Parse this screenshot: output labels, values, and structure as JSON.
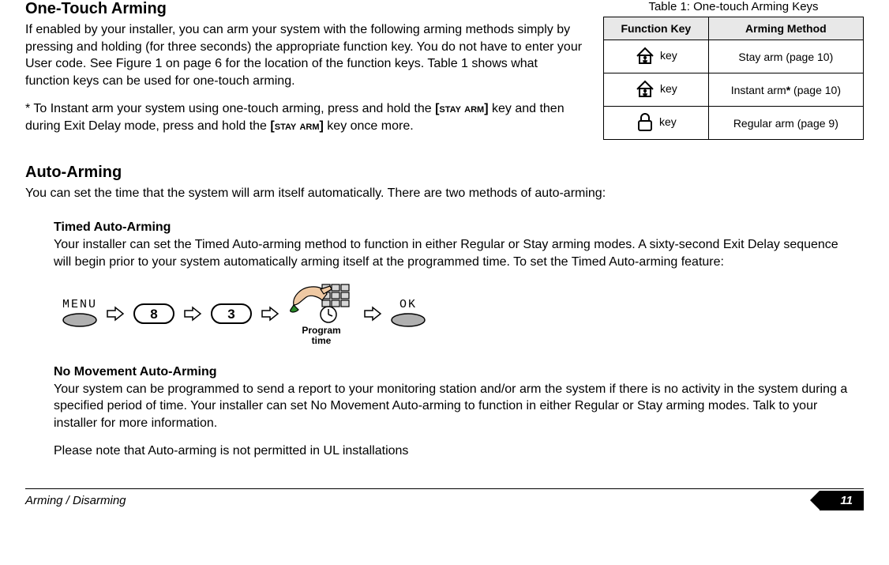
{
  "section1": {
    "heading": "One-Touch Arming",
    "p1": "If enabled by your installer, you can arm your system with the following arming methods simply by pressing and holding (for three seconds) the appropriate function key. You do not have to enter your User code. See Figure 1 on page 6 for the location of the function keys. Table 1 shows what function keys can be used for one-touch arming.",
    "p2a": "* To Instant arm your system using one-touch arming, press and hold the ",
    "p2b_key1": "[STAY ARM]",
    "p2c": " key and then during Exit Delay mode, press and hold the ",
    "p2d_key2": "[STAY ARM]",
    "p2e": " key once more."
  },
  "table": {
    "caption": "Table 1: One-touch Arming Keys",
    "headers": {
      "left": "Function Key",
      "right": "Arming Method"
    },
    "rows": [
      {
        "key_label": " key",
        "method": "Stay arm (page 10)"
      },
      {
        "key_label": " key",
        "method_pre": "Instant arm",
        "method_star": "*",
        "method_post": " (page 10)"
      },
      {
        "key_label": " key",
        "method": "Regular arm (page 9)"
      }
    ]
  },
  "section2": {
    "heading": "Auto-Arming",
    "p1": "You can set the time that the system will arm itself automatically. There are two methods of auto-arming:"
  },
  "timed": {
    "heading": "Timed Auto-Arming",
    "p1": "Your installer can set the Timed Auto-arming method to function in either Regular or Stay arming modes. A sixty-second Exit Delay sequence will begin prior to your system automatically arming itself at the programmed time. To set the Timed Auto-arming feature:",
    "diagram": {
      "menu_label": "MENU",
      "key1": "8",
      "key2": "3",
      "program_caption_l1": "Program",
      "program_caption_l2": "time",
      "ok_label": "OK"
    }
  },
  "nomove": {
    "heading": "No Movement Auto-Arming",
    "p1": "Your system can be programmed to send a report to your monitoring station and/or arm the system if there is no activity in the system during a specified period of time. Your installer can set No Movement Auto-arming to function in either Regular or Stay arming modes. Talk to your installer for more information.",
    "p2": "Please note that Auto-arming is not permitted in UL installations"
  },
  "footer": {
    "left": "Arming / Disarming",
    "right": "11"
  }
}
